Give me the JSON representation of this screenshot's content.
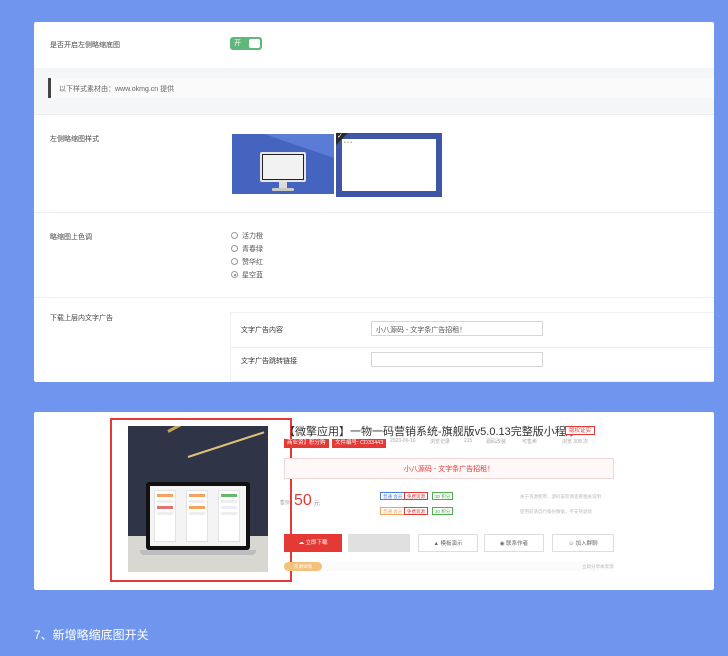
{
  "settings": {
    "toggle_label": "是否开启左侧略缩底图",
    "toggle_value": "开",
    "note": "以下样式素材由：www.okmg.cn 提供",
    "style_label": "左侧略缩图样式",
    "color_label": "略缩图上色调",
    "color_options": [
      {
        "label": "活力橙",
        "selected": false
      },
      {
        "label": "青春绿",
        "selected": false
      },
      {
        "label": "赞华红",
        "selected": false
      },
      {
        "label": "星空蓝",
        "selected": true
      }
    ],
    "ad_label": "下载上层内文字广告",
    "ad_content_label": "文字广告内容",
    "ad_content_value": "小八源码 - 文字条广告招租！",
    "ad_link_label": "文字广告跳转链接",
    "ad_link_value": ""
  },
  "preview": {
    "title": "【微擎应用】一物一码营销系统-旗舰版v5.0.13完整版小程序",
    "tag_right": "版权证实",
    "tags": [
      "商业资源",
      "积分购",
      "文件编号: CD33443"
    ],
    "meta": [
      "2020-06-16",
      "浏览记录",
      "215",
      "源码改装",
      "可售卖",
      "浏览 308 次"
    ],
    "ad_text": "小八源码 - 文字条广告招租！",
    "price_label": "售价",
    "price": "50",
    "price_unit": "元",
    "badges_row1": [
      "普通 会员",
      "免费资源",
      "30 积分"
    ],
    "badges_row2": [
      "普通 会员",
      "免费资源",
      "30 积分"
    ],
    "hint1": "关于资源使用、源码安装请查看相关说明",
    "hint2": "使用前请自行备份数据，不支持退款",
    "btn_download": "立即下载",
    "btn_demo": "",
    "btn_fav": "模板演示",
    "btn_share": "联系作者",
    "btn_join": "加入群聊",
    "pill": "资源详情",
    "bottom_right": "立即分享本资源"
  },
  "caption": "7、新增略缩底图开关",
  "colors": {
    "background": "#6f95ef",
    "toggle_on": "#5fb878",
    "accent_red": "#e53935",
    "thumb_blue": "#4564c0"
  }
}
